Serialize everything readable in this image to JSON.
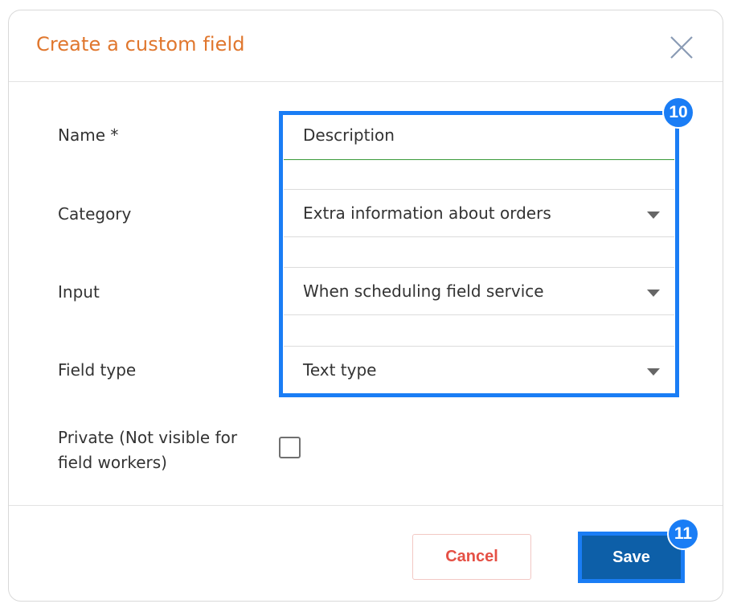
{
  "dialog": {
    "title": "Create a custom field",
    "close_icon": "close-icon"
  },
  "form": {
    "name": {
      "label": "Name *",
      "value": "Description"
    },
    "category": {
      "label": "Category",
      "value": "Extra information about orders"
    },
    "input": {
      "label": "Input",
      "value": "When scheduling field service"
    },
    "field_type": {
      "label": "Field type",
      "value": "Text type"
    },
    "private": {
      "label_line1": "Private (Not visible for",
      "label_line2": "field workers)",
      "checked": false
    }
  },
  "footer": {
    "cancel_label": "Cancel",
    "save_label": "Save"
  },
  "annotations": {
    "badge_fields": "10",
    "badge_save": "11"
  },
  "colors": {
    "title": "#e0772e",
    "highlight": "#1a7df5",
    "save_bg": "#0d5fa8",
    "cancel_text": "#e55045",
    "name_underline": "#3a9b3a"
  }
}
